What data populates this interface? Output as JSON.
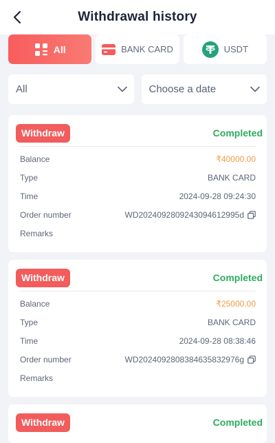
{
  "header": {
    "title": "Withdrawal history"
  },
  "tabs": [
    {
      "label": "All",
      "icon": "grid-icon"
    },
    {
      "label": "BANK CARD",
      "icon": "card-icon"
    },
    {
      "label": "USDT",
      "icon": "tether-icon"
    }
  ],
  "filters": {
    "type": "All",
    "date": "Choose a date"
  },
  "labels": {
    "balance": "Balance",
    "type": "Type",
    "time": "Time",
    "order": "Order number",
    "remarks": "Remarks"
  },
  "records": [
    {
      "badge": "Withdraw",
      "status": "Completed",
      "balance": "₹40000.00",
      "type": "BANK CARD",
      "time": "2024-09-28 09:24:30",
      "order": "WD2024092809243094612995d",
      "remarks": ""
    },
    {
      "badge": "Withdraw",
      "status": "Completed",
      "balance": "₹25000.00",
      "type": "BANK CARD",
      "time": "2024-09-28 08:38:46",
      "order": "WD2024092808384635832976g",
      "remarks": ""
    },
    {
      "badge": "Withdraw",
      "status": "Completed"
    }
  ],
  "colors": {
    "accent": "#f25c5c",
    "status_green": "#2fab5e",
    "amount_orange": "#f59a46",
    "tether": "#26a17b"
  }
}
